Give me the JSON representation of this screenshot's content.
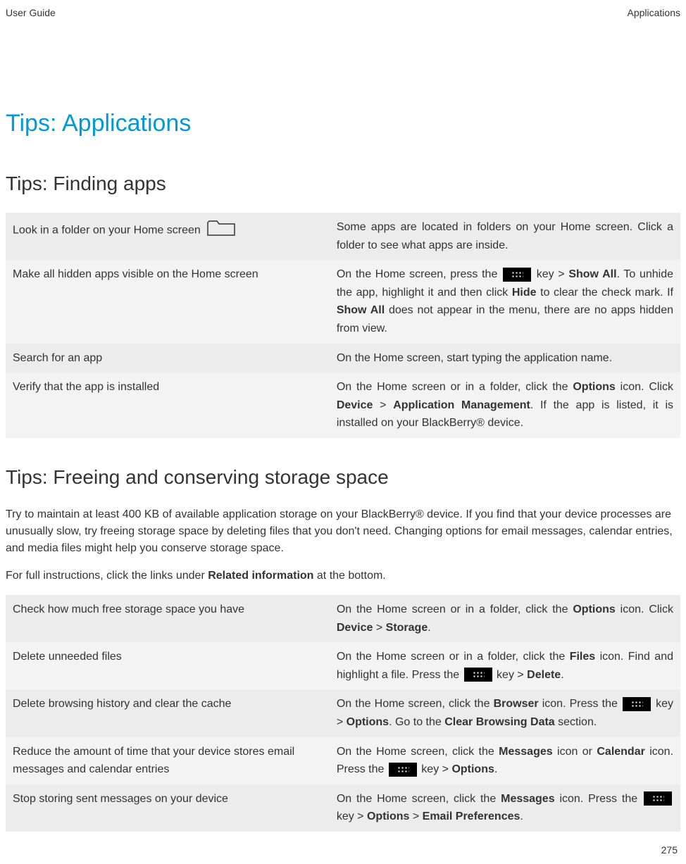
{
  "header": {
    "left": "User Guide",
    "right": "Applications"
  },
  "h1": "Tips: Applications",
  "section1": {
    "title": "Tips: Finding apps",
    "rows": [
      {
        "left": "Look in a folder on your Home screen",
        "right": "Some apps are located in folders on your Home screen. Click a folder to see what apps are inside."
      },
      {
        "left": "Make all hidden apps visible on the Home screen",
        "right_pre": "On the Home screen, press the ",
        "right_mid1": " key > ",
        "right_b1": "Show All",
        "right_mid2": ". To unhide the app, highlight it and then click ",
        "right_b2": "Hide",
        "right_mid3": " to clear the check mark. If ",
        "right_b3": "Show All",
        "right_post": " does not appear in the menu, there are no apps hidden from view."
      },
      {
        "left": "Search for an app",
        "right": "On the Home screen, start typing the application name."
      },
      {
        "left": "Verify that the app is installed",
        "right_pre": "On the Home screen or in a folder, click the ",
        "right_b1": "Options",
        "right_mid1": " icon. Click ",
        "right_b2": "Device",
        "right_mid2": " > ",
        "right_b3": "Application Management",
        "right_post": ". If the app is listed, it is installed on your BlackBerry® device."
      }
    ]
  },
  "section2": {
    "title": "Tips: Freeing and conserving storage space",
    "para1": "Try to maintain at least 400 KB of available application storage on your BlackBerry® device. If you find that your device processes are unusually slow, try freeing storage space by deleting files that you don't need. Changing options for email messages, calendar entries, and media files might help you conserve storage space.",
    "para2_pre": "For full instructions, click the links under ",
    "para2_b": "Related information",
    "para2_post": " at the bottom.",
    "rows": [
      {
        "left": "Check how much free storage space you have",
        "r_pre": "On the Home screen or in a folder, click the ",
        "r_b1": "Options",
        "r_mid1": " icon. Click ",
        "r_b2": "Device",
        "r_mid2": " > ",
        "r_b3": "Storage",
        "r_post": "."
      },
      {
        "left": "Delete unneeded files",
        "r_pre": "On the Home screen or in a folder, click the ",
        "r_b1": "Files",
        "r_mid1": " icon. Find and highlight a file. Press the ",
        "r_key": true,
        "r_mid2": " key > ",
        "r_b2": "Delete",
        "r_post": "."
      },
      {
        "left": "Delete browsing history and clear the cache",
        "r_pre": "On the Home screen, click the ",
        "r_b1": "Browser",
        "r_mid1": " icon. Press the ",
        "r_key": true,
        "r_mid2": " key > ",
        "r_b2": "Options",
        "r_mid3": ". Go to the ",
        "r_b3": "Clear Browsing Data",
        "r_post": " section."
      },
      {
        "left": "Reduce the amount of time that your device stores email messages and calendar entries",
        "r_pre": "On the Home screen, click the ",
        "r_b1": "Messages",
        "r_mid1": " icon or ",
        "r_b2": "Calendar",
        "r_mid2": " icon. Press the ",
        "r_key": true,
        "r_mid3": " key > ",
        "r_b3": "Options",
        "r_post": "."
      },
      {
        "left": "Stop storing sent messages on your device",
        "r_pre": "On the Home screen, click the ",
        "r_b1": "Messages",
        "r_mid1": " icon. Press the ",
        "r_key": true,
        "r_mid2": " key > ",
        "r_b2": "Options",
        "r_mid3": " > ",
        "r_b3": "Email Preferences",
        "r_post": "."
      }
    ]
  },
  "page_number": "275"
}
